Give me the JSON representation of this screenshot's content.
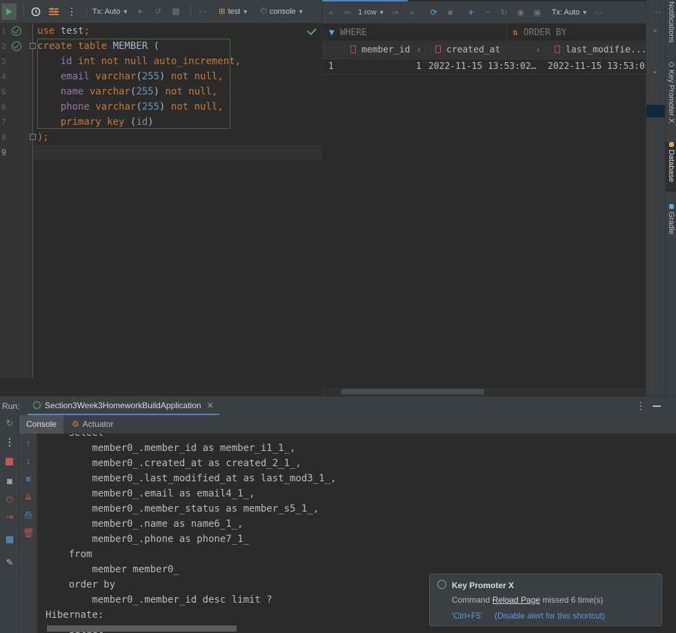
{
  "editor": {
    "toolbar": {
      "tx_mode": "Tx: Auto",
      "schema": "test",
      "session": "console",
      "more": "···"
    },
    "lines": [
      {
        "num": "1",
        "ok": true
      },
      {
        "num": "2",
        "ok": true
      },
      {
        "num": "3"
      },
      {
        "num": "4"
      },
      {
        "num": "5"
      },
      {
        "num": "6"
      },
      {
        "num": "7"
      },
      {
        "num": "8"
      },
      {
        "num": "9"
      }
    ],
    "code": [
      [
        {
          "t": "use ",
          "c": "kw"
        },
        {
          "t": "test",
          "c": ""
        },
        {
          "t": ";",
          "c": "kw"
        }
      ],
      [
        {
          "t": "create table ",
          "c": "kw"
        },
        {
          "t": "MEMBER (",
          "c": ""
        }
      ],
      [
        {
          "t": "    ",
          "c": ""
        },
        {
          "t": "id ",
          "c": "fld"
        },
        {
          "t": "int not null auto_increment,",
          "c": "kw"
        }
      ],
      [
        {
          "t": "    ",
          "c": ""
        },
        {
          "t": "email ",
          "c": "fld"
        },
        {
          "t": "varchar",
          "c": "kw"
        },
        {
          "t": "(",
          "c": ""
        },
        {
          "t": "255",
          "c": "num-c"
        },
        {
          "t": ") ",
          "c": ""
        },
        {
          "t": "not null,",
          "c": "kw"
        }
      ],
      [
        {
          "t": "    ",
          "c": ""
        },
        {
          "t": "name ",
          "c": "fld"
        },
        {
          "t": "varchar",
          "c": "kw"
        },
        {
          "t": "(",
          "c": ""
        },
        {
          "t": "255",
          "c": "num-c"
        },
        {
          "t": ") ",
          "c": ""
        },
        {
          "t": "not null,",
          "c": "kw"
        }
      ],
      [
        {
          "t": "    ",
          "c": ""
        },
        {
          "t": "phone ",
          "c": "fld"
        },
        {
          "t": "varchar",
          "c": "kw"
        },
        {
          "t": "(",
          "c": ""
        },
        {
          "t": "255",
          "c": "num-c"
        },
        {
          "t": ") ",
          "c": ""
        },
        {
          "t": "not null,",
          "c": "kw"
        }
      ],
      [
        {
          "t": "    ",
          "c": ""
        },
        {
          "t": "primary key ",
          "c": "kw"
        },
        {
          "t": "(",
          "c": ""
        },
        {
          "t": "id",
          "c": "fld"
        },
        {
          "t": ")",
          "c": ""
        }
      ],
      [
        {
          "t": ");",
          "c": "kw"
        }
      ],
      []
    ]
  },
  "results": {
    "toolbar": {
      "rows": "1 row",
      "tx_mode": "Tx: Auto",
      "more": "···"
    },
    "filter": {
      "where": "WHERE",
      "order_by": "ORDER BY"
    },
    "columns": [
      "member_id",
      "created_at",
      "last_modifie..."
    ],
    "rows": [
      {
        "index": "1",
        "cells": [
          "1",
          "2022-11-15 13:53:02…",
          "2022-11-15 13:53:0"
        ]
      }
    ]
  },
  "side_tabs": [
    "Notifications",
    "Key Promoter X",
    "Database",
    "Gradle"
  ],
  "run": {
    "label": "Run:",
    "config": "Section3Week3HomeworkBuildApplication",
    "tabs": [
      "Console",
      "Actuator"
    ],
    "output": [
      "    select",
      "        member0_.member_id as member_i1_1_,",
      "        member0_.created_at as created_2_1_,",
      "        member0_.last_modified_at as last_mod3_1_,",
      "        member0_.email as email4_1_,",
      "        member0_.member_status as member_s5_1_,",
      "        member0_.name as name6_1_,",
      "        member0_.phone as phone7_1_",
      "    from",
      "        member member0_",
      "    order by",
      "        member0_.member_id desc limit ?",
      "Hibernate:",
      "    select"
    ]
  },
  "notification": {
    "title": "Key Promoter X",
    "msg_prefix": "Command ",
    "msg_action": "Reload Page",
    "msg_suffix": " missed 6 time(s)",
    "shortcut": "'Ctrl+F5'",
    "disable": "(Disable alert for this shortcut)"
  },
  "colors": {
    "accent": "#4a88c7",
    "success": "#59a869",
    "keyword": "#cc7832",
    "field": "#9876aa",
    "number": "#6897bb",
    "link": "#589df6",
    "stop": "#c75450"
  }
}
